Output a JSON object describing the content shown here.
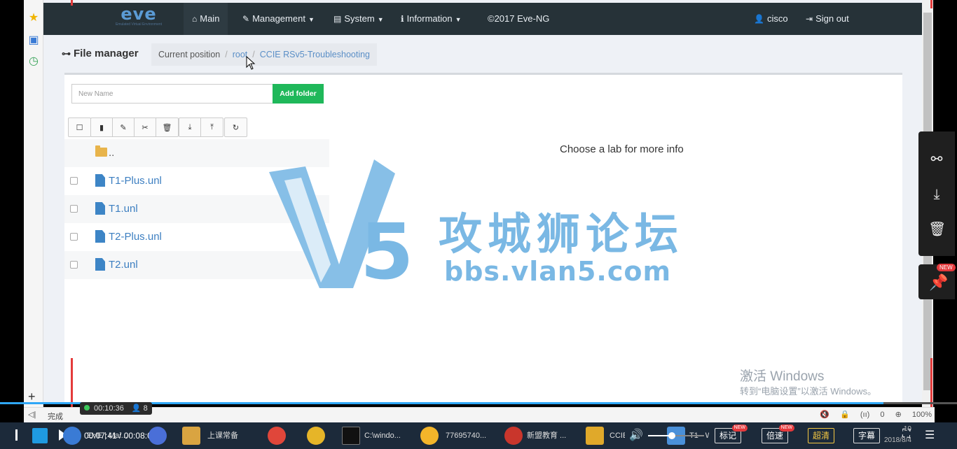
{
  "navbar": {
    "logo": "eve",
    "logo_sub": "Emulated Virtual Environment",
    "items": [
      {
        "label": "Main",
        "icon": "home-icon",
        "glyph": "⌂"
      },
      {
        "label": "Management",
        "icon": "wrench-icon",
        "glyph": "🔧"
      },
      {
        "label": "System",
        "icon": "book-icon",
        "glyph": "▤"
      },
      {
        "label": "Information",
        "icon": "info-icon",
        "glyph": "ℹ"
      },
      {
        "label": "©2017 Eve-NG"
      }
    ],
    "user": "cisco",
    "signout": "Sign out"
  },
  "file_manager": {
    "title": "File manager",
    "breadcrumb": {
      "label": "Current position",
      "root": "root",
      "folder": "CCIE RSv5-Troubleshooting"
    },
    "new_name_placeholder": "New Name",
    "add_folder": "Add folder",
    "toolbar": [
      "select-all",
      "new-file",
      "rename",
      "cut",
      "delete",
      "import",
      "export",
      "refresh"
    ],
    "parent": "..",
    "files": [
      "T1-Plus.unl",
      "T1.unl",
      "T2-Plus.unl",
      "T2.unl"
    ],
    "lab_info": "Choose a lab for more info"
  },
  "watermark": {
    "letters": "V5",
    "cn": "攻城狮论坛",
    "url": "bbs.vlan5.com"
  },
  "activate": {
    "line1": "激活 Windows",
    "line2": "转到“电脑设置”以激活 Windows。"
  },
  "status_bar": {
    "done": "完成",
    "zoom": "100%",
    "count": "0"
  },
  "recording": {
    "elapsed": "00:10:36",
    "viewers": "8"
  },
  "player": {
    "time": "00:07:41 / 00:08:00",
    "progress": 0.961,
    "volume": 0.42,
    "buttons": {
      "mark": "标记",
      "speed": "倍速",
      "hd": "超清",
      "subtitle": "字幕"
    },
    "new_badge": "NEW"
  },
  "taskbar": {
    "items": [
      "EVE | Mai...",
      "上课常备",
      "C:\\windo...",
      "77695740...",
      "新盟教育 ...",
      "CCIE LAB ...",
      "T1 - Wind..."
    ],
    "date": "2018/8/4",
    "time": "10"
  },
  "colors": {
    "navbar": "#263238",
    "accent": "#3d7fc1",
    "add_folder": "#1fb85a",
    "watermark": "#7ab8e4"
  }
}
